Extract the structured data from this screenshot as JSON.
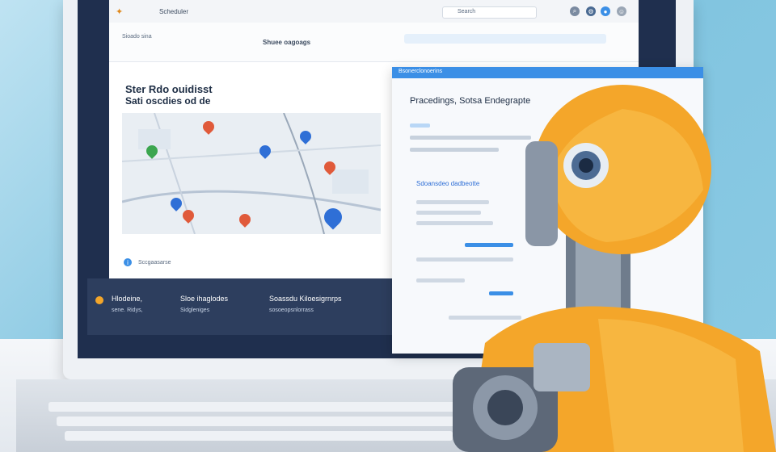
{
  "header": {
    "brand_text": "Scheduler",
    "search_placeholder": "Search"
  },
  "nav": {
    "link_1": "Sioado sina",
    "link_2": "Shuee oagoags"
  },
  "hero": {
    "title_line_1": "Ster Rdo ouidisst",
    "title_line_2": "Sati oscdies od de"
  },
  "map_footer": {
    "label": "Sccgaasarse"
  },
  "bottom_bar": {
    "item_1": "Hlodeine,",
    "item_1_sub": "sene. Ridys,",
    "item_2": "Sloe ihaglodes",
    "item_2_sub": "Sidgleniges",
    "item_3": "Soassdu Kiloesigrnrps",
    "item_3_sub": "sosoeopsnlorrass"
  },
  "panel": {
    "header": "Bsonerclonoerins",
    "title": "Pracedings, Sotsa Endegrapte",
    "section": "Sdoansdeo dadbeotte"
  },
  "colors": {
    "primary": "#3b8fe6",
    "dark_band": "#2d3e5e",
    "robot_orange": "#f4a62a"
  }
}
